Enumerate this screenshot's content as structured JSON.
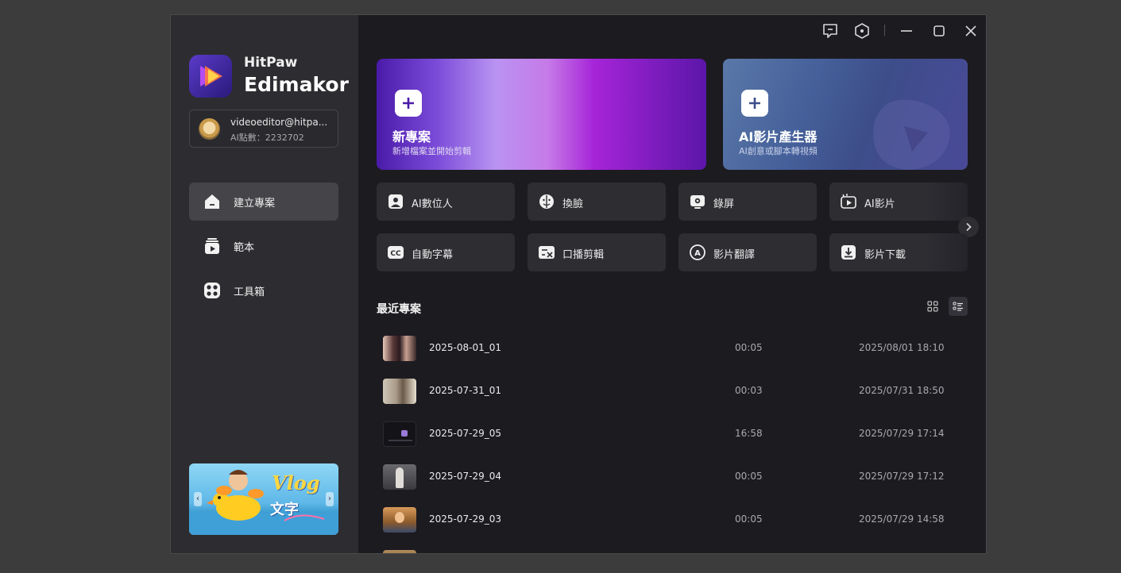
{
  "brand": {
    "line1": "HitPaw",
    "line2": "Edimakor"
  },
  "account": {
    "name": "videoeditor@hitpa...",
    "points": "AI點數：2232702"
  },
  "sidebar": {
    "items": [
      {
        "label": "建立專案",
        "icon": "home-icon",
        "active": true
      },
      {
        "label": "範本",
        "icon": "template-icon",
        "active": false
      },
      {
        "label": "工具箱",
        "icon": "toolbox-icon",
        "active": false
      }
    ],
    "banner": {
      "text1": "Vlog",
      "text2": "文字"
    }
  },
  "hero": {
    "new": {
      "title": "新專案",
      "subtitle": "新增檔案並開始剪輯"
    },
    "ai": {
      "title": "AI影片產生器",
      "subtitle": "AI創意或腳本轉視頻"
    }
  },
  "tools": [
    {
      "label": "AI數位人",
      "icon": "avatar-icon"
    },
    {
      "label": "換臉",
      "icon": "face-swap-icon"
    },
    {
      "label": "錄屏",
      "icon": "screen-record-icon"
    },
    {
      "label": "AI影片",
      "icon": "ai-video-icon"
    },
    {
      "label": "自動字幕",
      "icon": "subtitle-cc-icon"
    },
    {
      "label": "口播剪輯",
      "icon": "speech-cut-icon"
    },
    {
      "label": "影片翻譯",
      "icon": "translate-icon"
    },
    {
      "label": "影片下載",
      "icon": "download-icon"
    }
  ],
  "recent": {
    "title": "最近專案",
    "projects": [
      {
        "name": "2025-08-01_01",
        "duration": "00:05",
        "date": "2025/08/01 18:10"
      },
      {
        "name": "2025-07-31_01",
        "duration": "00:03",
        "date": "2025/07/31 18:50"
      },
      {
        "name": "2025-07-29_05",
        "duration": "16:58",
        "date": "2025/07/29 17:14"
      },
      {
        "name": "2025-07-29_04",
        "duration": "00:05",
        "date": "2025/07/29 17:12"
      },
      {
        "name": "2025-07-29_03",
        "duration": "00:05",
        "date": "2025/07/29 14:58"
      }
    ]
  },
  "colors": {
    "accent": "#8b3fd9",
    "background": "#1c1b20",
    "sidebar": "#2d2d31",
    "panel": "#2e2d32"
  }
}
